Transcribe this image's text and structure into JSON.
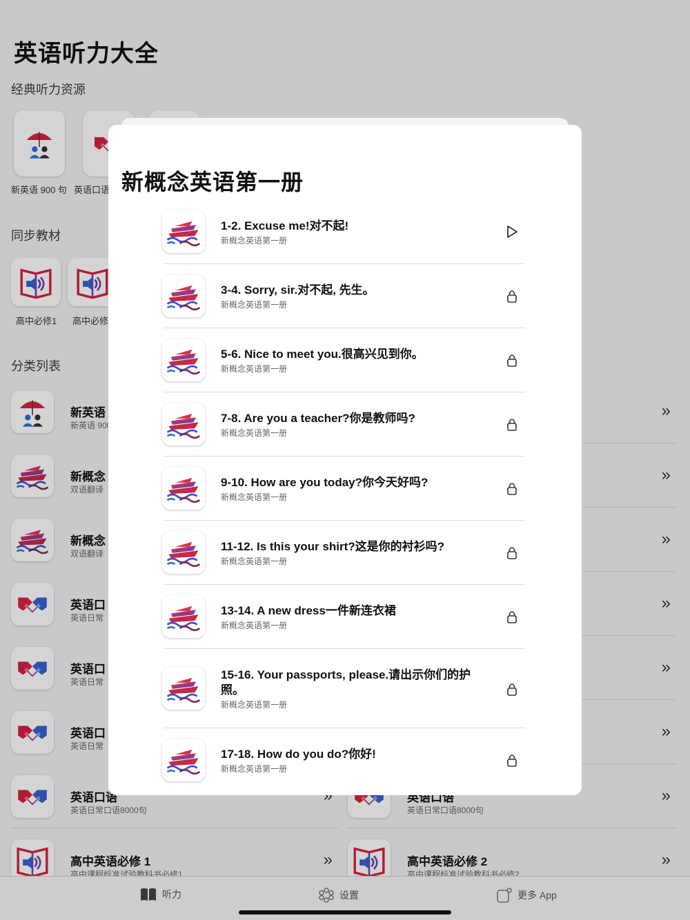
{
  "app": {
    "title": "英语听力大全"
  },
  "sections": {
    "classic": "经典听力资源",
    "sync": "同步教材",
    "category": "分类列表"
  },
  "classic_tiles": [
    {
      "label": "新英语 900 句",
      "icon": "umbrella-family-icon"
    },
    {
      "label": "英语口语",
      "icon": "handshake-icon"
    }
  ],
  "sync_tiles": [
    {
      "label": "高中必修1",
      "icon": "book-speaker-icon"
    },
    {
      "label": "高中必修",
      "icon": "book-speaker-icon"
    }
  ],
  "category_rows": [
    {
      "title": "新英语",
      "subtitle": "新英语 900",
      "icon": "umbrella-family-icon"
    },
    {
      "title": "新概念",
      "subtitle": "双语翻译",
      "icon": "ship-icon"
    },
    {
      "title": "新概念",
      "subtitle": "双语翻译",
      "icon": "ship-icon"
    },
    {
      "title": "英语口",
      "subtitle": "英语日常",
      "icon": "handshake-icon"
    },
    {
      "title": "英语口",
      "subtitle": "英语日常",
      "icon": "handshake-icon"
    },
    {
      "title": "英语口",
      "subtitle": "英语日常",
      "icon": "handshake-icon"
    }
  ],
  "bottom_rows": [
    {
      "title": "英语口语",
      "subtitle": "英语日常口语8000句",
      "icon": "handshake-icon"
    },
    {
      "title": "英语口语",
      "subtitle": "英语日常口语8000句",
      "icon": "handshake-icon"
    },
    {
      "title": "高中英语必修 1",
      "subtitle": "高中课程标准试验教科书必修1",
      "icon": "book-speaker-icon"
    },
    {
      "title": "高中英语必修 2",
      "subtitle": "高中课程标准试验教科书必修2",
      "icon": "book-speaker-icon"
    }
  ],
  "tabbar": {
    "listen": "听力",
    "settings": "设置",
    "more": "更多 App"
  },
  "sheet": {
    "title": "新概念英语第一册",
    "items": [
      {
        "title": "1-2. Excuse me!对不起!",
        "subtitle": "新概念英语第一册",
        "action": "play-icon"
      },
      {
        "title": "3-4. Sorry, sir.对不起, 先生。",
        "subtitle": "新概念英语第一册",
        "action": "lock-icon"
      },
      {
        "title": "5-6. Nice to meet you.很高兴见到你。",
        "subtitle": "新概念英语第一册",
        "action": "lock-icon"
      },
      {
        "title": "7-8. Are you a teacher?你是教师吗?",
        "subtitle": "新概念英语第一册",
        "action": "lock-icon"
      },
      {
        "title": "9-10. How are you today?你今天好吗?",
        "subtitle": "新概念英语第一册",
        "action": "lock-icon"
      },
      {
        "title": "11-12. Is this your shirt?这是你的衬衫吗?",
        "subtitle": "新概念英语第一册",
        "action": "lock-icon"
      },
      {
        "title": "13-14. A new dress一件新连衣裙",
        "subtitle": "新概念英语第一册",
        "action": "lock-icon"
      },
      {
        "title": "15-16. Your passports, please.请出示你们的护照。",
        "subtitle": "新概念英语第一册",
        "action": "lock-icon"
      },
      {
        "title": "17-18. How do you do?你好!",
        "subtitle": "新概念英语第一册",
        "action": "lock-icon"
      }
    ]
  },
  "colors": {
    "accent_red": "#d6243e",
    "accent_blue": "#2f6fd8",
    "accent_purple": "#7a3fa8"
  }
}
